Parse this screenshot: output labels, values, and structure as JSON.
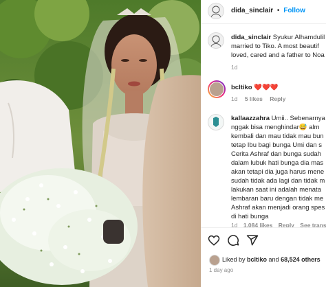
{
  "header": {
    "username": "dida_sinclair",
    "dot": "•",
    "follow_label": "Follow"
  },
  "caption": {
    "username": "dida_sinclair",
    "lines": [
      "Syukur Alhamdulil",
      "married to Tiko. A most beautif",
      "loved, cared and a father to Noa"
    ],
    "time": "1d"
  },
  "comments": [
    {
      "username": "bcltiko",
      "text": "❤️❤️❤️",
      "time": "1d",
      "likes": "5 likes",
      "reply": "Reply"
    },
    {
      "username": "kallaazzahra",
      "lines": [
        "Umii.. Sebenarnya",
        "nggak bisa menghindar😅  alm",
        "kembali dan mau tidak mau bun",
        "tetap Ibu bagi bunga Umi dan s",
        "Cerita Ashraf dan bunga sudah",
        "dalam lubuk hati bunga dia mas",
        "akan tetapi dia juga harus mene",
        "sudah tidak ada lagi dan tidak m",
        "lakukan saat ini adalah menata",
        "lembaran baru dengan tidak me",
        "Ashraf akan menjadi orang spes",
        "di hati bunga"
      ],
      "time": "1d",
      "likes": "1,084 likes",
      "reply": "Reply",
      "translation": "See translation"
    }
  ],
  "actions": {
    "like_icon": "heart-outline-icon",
    "comment_icon": "comment-bubble-icon",
    "share_icon": "paper-plane-icon"
  },
  "likes_summary": {
    "prefix": "Liked by ",
    "user": "bcltiko",
    "middle": " and ",
    "count": "68,524 others"
  },
  "post_time": "1 day ago",
  "colors": {
    "accent": "#0095f6",
    "heart": "#ed4956",
    "muted": "#8e8e8e"
  }
}
